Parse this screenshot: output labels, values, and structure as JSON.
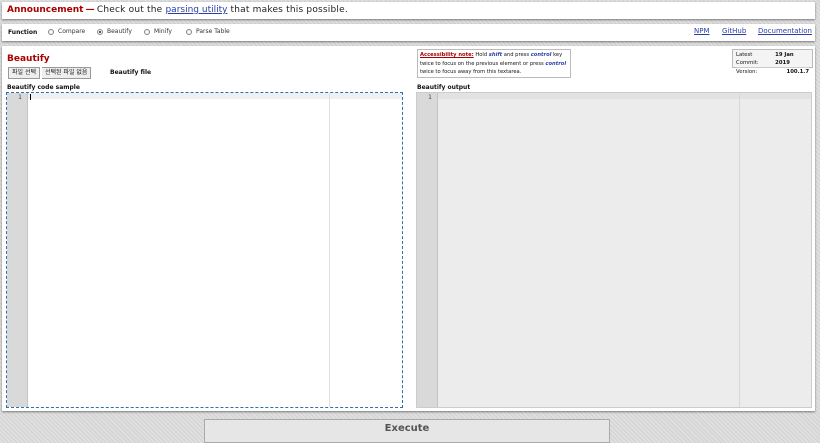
{
  "announcement": {
    "label": "Announcement",
    "dash": "—",
    "text_before": "Check out the ",
    "link": "parsing utility",
    "text_after": " that makes this possible."
  },
  "function_bar": {
    "label": "Function",
    "options": [
      "Compare",
      "Beautify",
      "Minify",
      "Parse Table"
    ],
    "selected": "Beautify",
    "links": [
      "NPM",
      "GitHub",
      "Documentation"
    ]
  },
  "beautify": {
    "title": "Beautify",
    "file_button": "파일 선택",
    "file_status": "선택된 파일 없음",
    "file_label": "Beautify file",
    "code_label": "Beautify code sample",
    "output_label": "Beautify output",
    "line_number": "1"
  },
  "accessibility": {
    "title": "Accessibility note:",
    "t1": " Hold ",
    "k1": "shift",
    "t2": " and press ",
    "k2": "control",
    "t3": " key twice to focus on the previous element or press ",
    "k3": "control",
    "t4": " twice to focus away from this textarea."
  },
  "commit": {
    "latest_label": "Latest Commit:",
    "latest_value": "19 Jan 2019",
    "version_label": "Version:",
    "version_value": "100.1.7"
  },
  "execute_label": "Execute"
}
